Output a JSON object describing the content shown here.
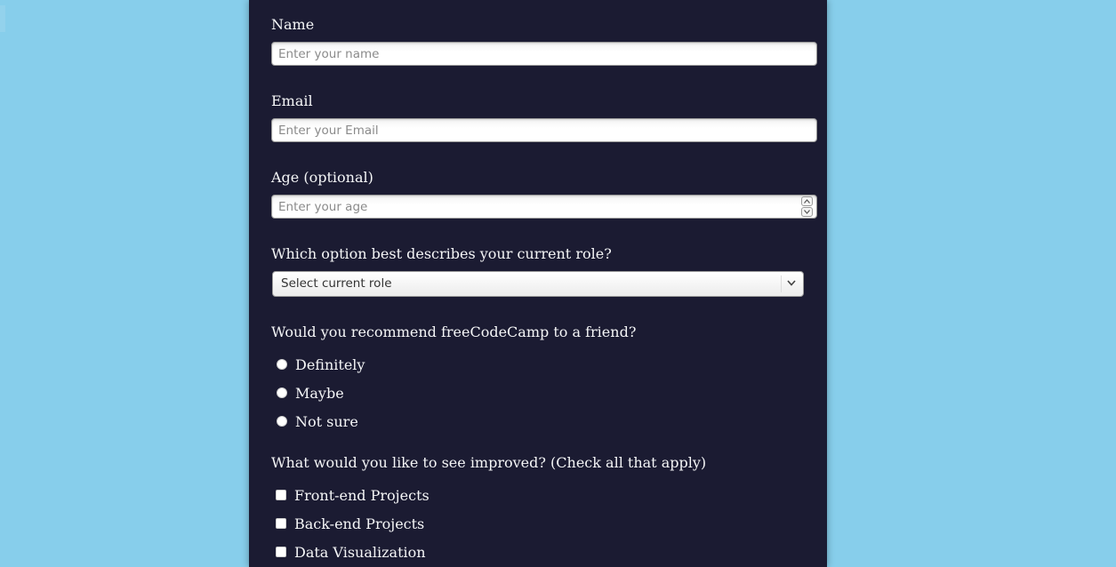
{
  "form": {
    "name": {
      "label": "Name",
      "placeholder": "Enter your name",
      "value": ""
    },
    "email": {
      "label": "Email",
      "placeholder": "Enter your Email",
      "value": ""
    },
    "age": {
      "label": "Age (optional)",
      "placeholder": "Enter your age",
      "value": ""
    },
    "role": {
      "label": "Which option best describes your current role?",
      "selected": "Select current role"
    },
    "recommend": {
      "label": "Would you recommend freeCodeCamp to a friend?",
      "options": [
        {
          "label": "Definitely",
          "checked": false
        },
        {
          "label": "Maybe",
          "checked": false
        },
        {
          "label": "Not sure",
          "checked": false
        }
      ]
    },
    "improve": {
      "label": "What would you like to see improved? (Check all that apply)",
      "options": [
        {
          "label": "Front-end Projects",
          "checked": false
        },
        {
          "label": "Back-end Projects",
          "checked": false
        },
        {
          "label": "Data Visualization",
          "checked": false
        }
      ]
    }
  },
  "colors": {
    "page_background": "#87ceeb",
    "panel_background": "#1b1b32",
    "text": "#f5f6f7"
  }
}
